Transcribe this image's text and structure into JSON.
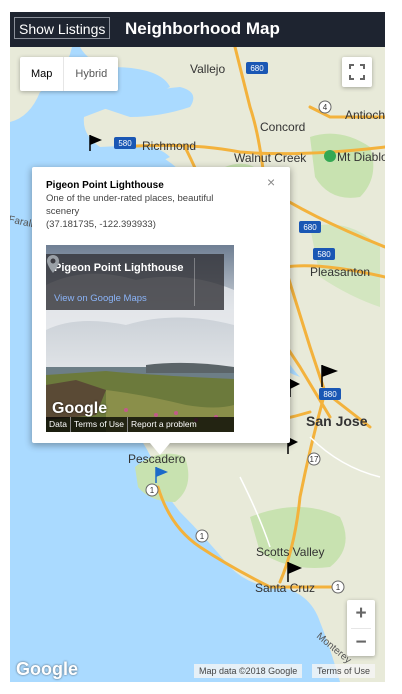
{
  "header": {
    "show_listings_label": "Show Listings",
    "title": "Neighborhood Map"
  },
  "map": {
    "maptype": {
      "map_label": "Map",
      "hybrid_label": "Hybrid",
      "selected": "Map"
    },
    "zoom": {
      "in_label": "+",
      "out_label": "−"
    },
    "google_label": "Google",
    "attribution": "Map data ©2018 Google",
    "terms_label": "Terms of Use",
    "place_labels": {
      "vallejo": "Vallejo",
      "richmond": "Richmond",
      "concord": "Concord",
      "antioch": "Antioch",
      "walnut_creek": "Walnut Creek",
      "mt_diablo": "Mt Diablo",
      "pleasanton": "Pleasanton",
      "san_jose": "San Jose",
      "pescadero": "Pescadero",
      "scotts_valley": "Scotts Valley",
      "santa_cruz": "Santa Cruz",
      "monterey_bay": "Monterey",
      "farallones": "Farallones"
    },
    "route_shields": [
      "580",
      "680",
      "4",
      "680",
      "580",
      "880",
      "17",
      "1",
      "1",
      "1"
    ]
  },
  "info_window": {
    "title": "Pigeon Point Lighthouse",
    "description": "One of the under-rated places, beautiful scenery",
    "coordinates": "(37.181735, -122.393933)",
    "close_label": "×",
    "streetview": {
      "title": "Pigeon Point Lighthouse",
      "link_label": "View on Google Maps",
      "google_label": "Google",
      "footer": {
        "data": "Data",
        "terms": "Terms of Use",
        "report": "Report a problem"
      }
    }
  },
  "colors": {
    "header_bg": "#1e2430",
    "water": "#aadaff",
    "land": "#e8ead9",
    "park": "#c8e2b0",
    "freeway": "#f3b23c",
    "marker_selected": "#1b6ac9",
    "marker_default": "#000000"
  }
}
